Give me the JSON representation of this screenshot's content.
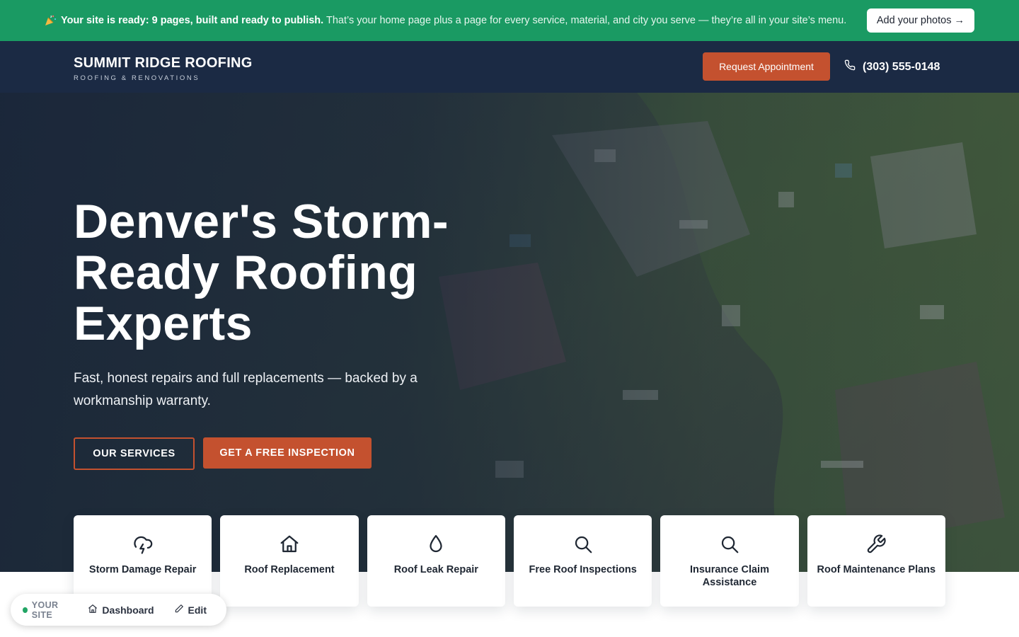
{
  "banner": {
    "icon": "party-popper-icon",
    "bold_text": "Your site is ready: 9 pages, built and ready to publish.",
    "rest_text": "That’s your home page plus a page for every service, material, and city you serve — they’re all in your site’s menu.",
    "button_label": "Add your photos →"
  },
  "header": {
    "logo_title": "SUMMIT RIDGE ROOFING",
    "logo_subtitle": "ROOFING & RENOVATIONS",
    "appointment_label": "Request Appointment",
    "phone": "(303) 555-0148"
  },
  "hero": {
    "title_line1": "Denver's Storm-",
    "title_line2": "Ready Roofing",
    "title_line3": "Experts",
    "subtitle": "Fast, honest repairs and full replacements — backed by a workmanship warranty.",
    "primary_button": "OUR SERVICES",
    "secondary_button": "GET A FREE INSPECTION"
  },
  "services": [
    {
      "label": "Storm Damage Repair",
      "icon": "storm-cloud-icon"
    },
    {
      "label": "Roof Replacement",
      "icon": "house-icon"
    },
    {
      "label": "Roof Leak Repair",
      "icon": "water-drop-icon"
    },
    {
      "label": "Free Roof Inspections",
      "icon": "magnifier-icon"
    },
    {
      "label": "Insurance Claim Assistance",
      "icon": "magnifier-icon"
    },
    {
      "label": "Roof Maintenance Plans",
      "icon": "wrench-icon"
    }
  ],
  "site_bar": {
    "status": "YOUR SITE",
    "dashboard_label": "Dashboard",
    "edit_label": "Edit"
  },
  "colors": {
    "banner_green": "#1a9a63",
    "header_navy": "#1b2a44",
    "accent_orange": "#c4512f"
  }
}
